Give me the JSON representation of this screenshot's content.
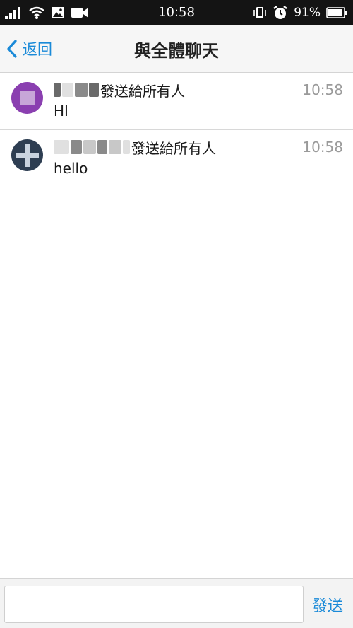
{
  "status_bar": {
    "time": "10:58",
    "battery_percent": "91%",
    "battery_level": 0.91,
    "icons_left": [
      "signal-icon",
      "wifi-icon",
      "image-icon",
      "video-camera-icon"
    ],
    "icons_right": [
      "phone-vibrate-icon",
      "alarm-icon",
      "battery-icon"
    ]
  },
  "nav": {
    "back_label": "返回",
    "title": "與全體聊天"
  },
  "messages": [
    {
      "sender_suffix": "發送給所有人",
      "time": "10:58",
      "text": "HI",
      "avatar": "purple"
    },
    {
      "sender_suffix": "發送給所有人",
      "time": "10:58",
      "text": "hello",
      "avatar": "dark"
    }
  ],
  "composer": {
    "input_value": "",
    "send_label": "發送"
  },
  "colors": {
    "accent": "#1a8ad8",
    "status_bar_bg": "#141414",
    "nav_bg": "#f6f6f6"
  }
}
